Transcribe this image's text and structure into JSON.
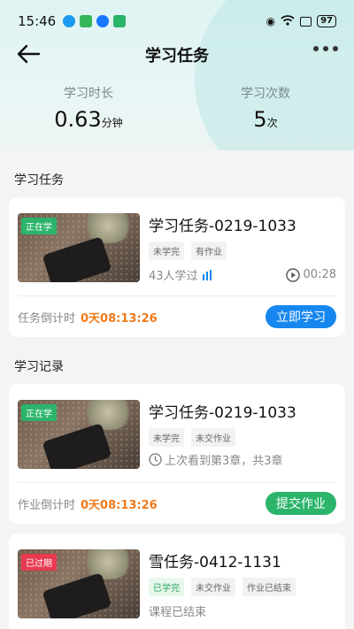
{
  "status_bar": {
    "time": "15:46",
    "battery": "97"
  },
  "nav": {
    "title": "学习任务"
  },
  "stats": [
    {
      "label": "学习时长",
      "value": "0.63",
      "unit": "分钟"
    },
    {
      "label": "学习次数",
      "value": "5",
      "unit": "次"
    }
  ],
  "sections": {
    "tasks": "学习任务",
    "records": "学习记录"
  },
  "task_card": {
    "badge": "正在学",
    "title": "学习任务-0219-1033",
    "tags": [
      "未学完",
      "有作业"
    ],
    "learners": "43人学过",
    "duration": "00:28",
    "countdown_label": "任务倒计时",
    "countdown": "0天08:13:26",
    "button": "立即学习"
  },
  "record_cards": [
    {
      "badge": "正在学",
      "title": "学习任务-0219-1033",
      "tags": [
        "未学完",
        "未交作业"
      ],
      "progress": "上次看到第3章，共3章",
      "countdown_label": "作业倒计时",
      "countdown": "0天08:13:26",
      "button": "提交作业"
    },
    {
      "badge": "已过期",
      "title": "雪任务-0412-1131",
      "tags": [
        "已学完",
        "未交作业",
        "作业已结束"
      ],
      "status": "课程已结束"
    }
  ],
  "colors": {
    "accent_blue": "#1787f0",
    "accent_green": "#2bb46a",
    "countdown": "#f07a1a",
    "expired": "#e83a50"
  }
}
